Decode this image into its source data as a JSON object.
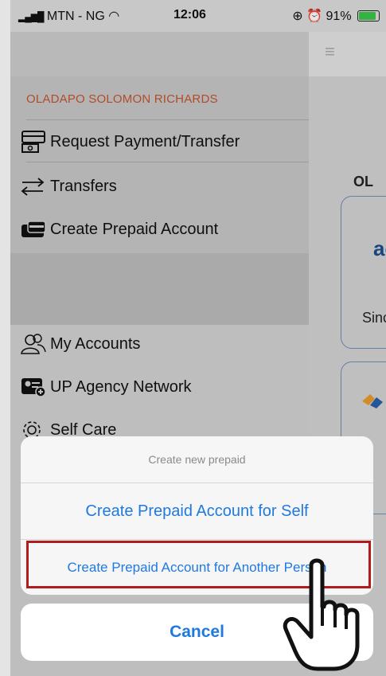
{
  "status": {
    "carrier": "MTN - NG",
    "time": "12:06",
    "battery": "91%"
  },
  "drawer": {
    "username": "OLADAPO SOLOMON RICHARDS",
    "items": [
      {
        "label": "Request Payment/Transfer",
        "icon": "request-payment-icon"
      },
      {
        "label": "Transfers",
        "icon": "transfer-arrows-icon"
      },
      {
        "label": "Create Prepaid Account",
        "icon": "card-icon"
      },
      {
        "label": "My Accounts",
        "icon": "accounts-icon"
      },
      {
        "label": "UP Agency Network",
        "icon": "agency-icon"
      },
      {
        "label": "Self Care",
        "icon": "gear-icon"
      }
    ]
  },
  "main": {
    "name_partial": "OL",
    "card1_logo": "acc",
    "card1_text": "Sinc"
  },
  "action_sheet": {
    "title": "Create new prepaid",
    "option_self": "Create Prepaid Account for Self",
    "option_other": "Create Prepaid Account for Another Person",
    "cancel": "Cancel"
  },
  "colors": {
    "accent": "#1f7ae0",
    "highlight": "#b01c1c",
    "username": "#c2532c"
  }
}
